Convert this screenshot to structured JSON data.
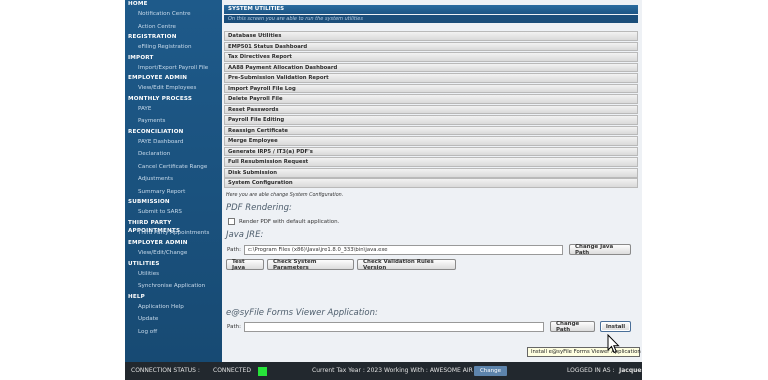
{
  "sidebar": {
    "sections": [
      {
        "label": "HOME",
        "items": [
          "Notification Centre",
          "Action Centre"
        ]
      },
      {
        "label": "REGISTRATION",
        "items": [
          "eFiling Registration"
        ]
      },
      {
        "label": "IMPORT",
        "items": [
          "Import/Export Payroll File"
        ]
      },
      {
        "label": "EMPLOYEE ADMIN",
        "items": [
          "View/Edit Employees"
        ]
      },
      {
        "label": "MONTHLY PROCESS",
        "items": [
          "PAYE",
          "Payments"
        ]
      },
      {
        "label": "RECONCILIATION",
        "items": [
          "PAYE Dashboard",
          "Declaration",
          "Cancel Certificate Range",
          "Adjustments",
          "Summary Report"
        ]
      },
      {
        "label": "SUBMISSION",
        "items": [
          "Submit to SARS"
        ]
      },
      {
        "label": "THIRD PARTY APPOINTMENTS",
        "items": [
          "Third Party Appointments"
        ]
      },
      {
        "label": "EMPLOYER ADMIN",
        "items": [
          "View/Edit/Change"
        ]
      },
      {
        "label": "UTILITIES",
        "items": [
          "Utilities",
          "Synchronise Application"
        ]
      },
      {
        "label": "HELP",
        "items": [
          "Application Help",
          "Update",
          "Log off"
        ]
      }
    ]
  },
  "main": {
    "title": "SYSTEM UTILITIES",
    "subtitle": "On this screen you are able to run the system utilities",
    "utilities": [
      "Database Utilities",
      "EMP501 Status Dashboard",
      "Tax Directives Report",
      "AA88 Payment Allocation Dashboard",
      "Pre-Submission Validation Report",
      "Import Payroll File Log",
      "Delete Payroll File",
      "Reset Passwords",
      "Payroll File Editing",
      "Reassign Certificate",
      "Merge Employee",
      "Generate IRP5 / IT3(a) PDF's",
      "Full Resubmission Request",
      "Disk Submission",
      "System Configuration"
    ],
    "config_note": "Here you are able change System Configuration.",
    "pdf_section": {
      "title": "PDF Rendering:",
      "checkbox_label": "Render PDF with default application."
    },
    "jre_section": {
      "title": "Java JRE:",
      "path_label": "Path:",
      "path_value": "c:\\Program Files (x86)\\Java\\jre1.8.0_333\\bin\\java.exe",
      "change_button": "Change Java Path",
      "test_button": "Test Java",
      "check_params_button": "Check System Parameters",
      "check_rules_button": "Check Validation Rules Version"
    },
    "viewer_section": {
      "title": "e@syFile Forms Viewer Application:",
      "path_label": "Path:",
      "path_value": "",
      "change_button": "Change Path",
      "install_button": "Install",
      "tooltip": "Install e@syFile Forms Viewer Application"
    }
  },
  "status_bar": {
    "connection_label": "CONNECTION STATUS :",
    "connection_value": "CONNECTED",
    "connection_color": "#27e43a",
    "tax_year": "Current Tax Year : 2023",
    "working_with": "Working With : AWESOME AIR",
    "change_button": "Change",
    "logged_in": "LOGGED IN AS :",
    "user": "Jacques"
  }
}
